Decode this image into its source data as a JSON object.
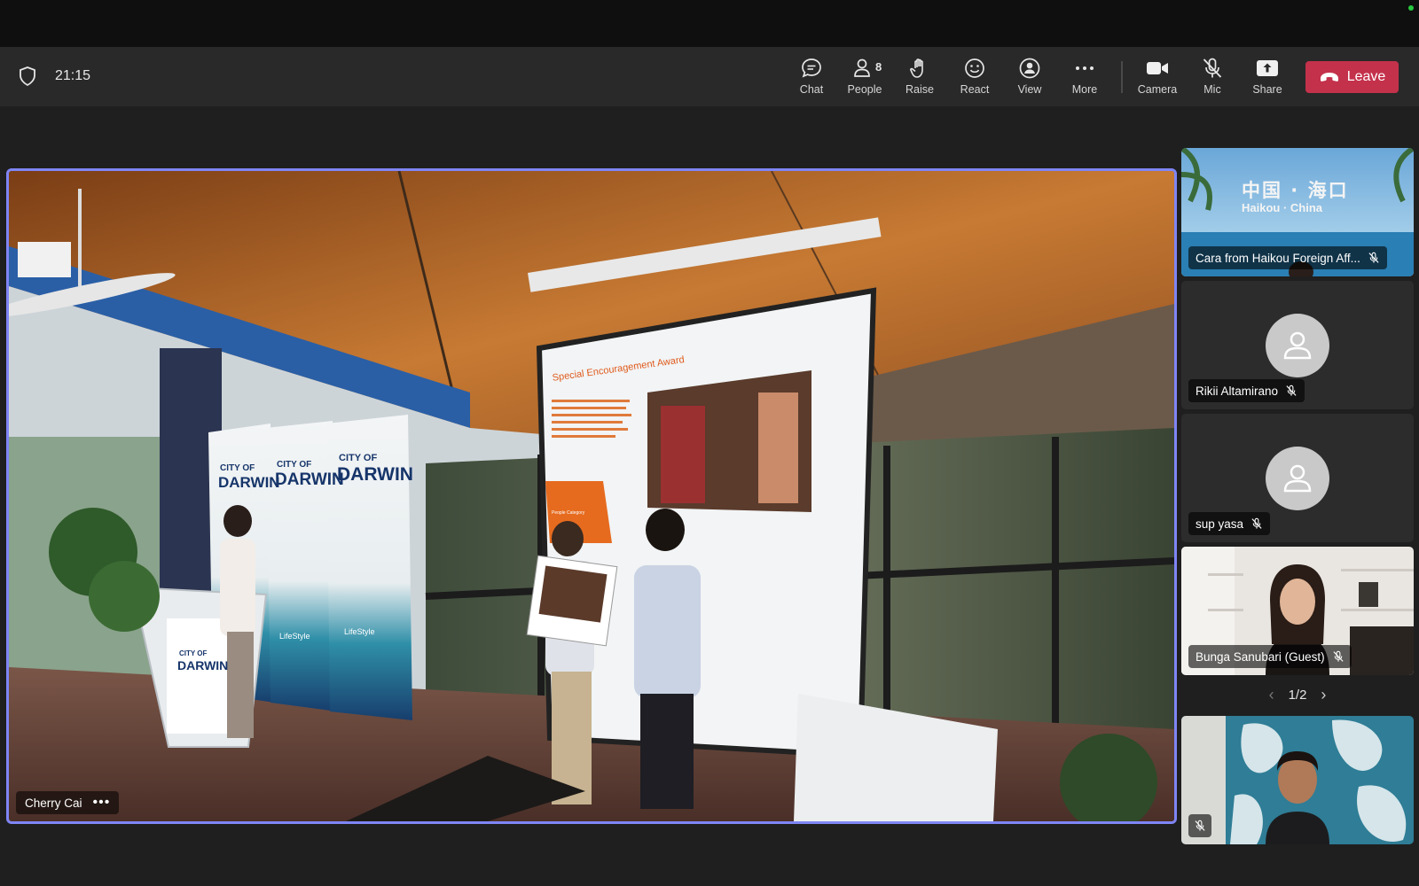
{
  "meeting": {
    "time": "21:15"
  },
  "toolbar": {
    "chat": "Chat",
    "people": "People",
    "people_count": "8",
    "raise": "Raise",
    "react": "React",
    "view": "View",
    "more": "More",
    "camera": "Camera",
    "mic": "Mic",
    "share": "Share",
    "leave": "Leave"
  },
  "main_speaker": {
    "name": "Cherry Cai"
  },
  "slide": {
    "title": "Special Encouragement Award",
    "caption": "People Category"
  },
  "scene": {
    "banner_line1": "CITY OF",
    "banner_line2": "DARWIN",
    "banner_slogan": "LifeStyle"
  },
  "participants": [
    {
      "name": "Cara from Haikou Foreign Aff...",
      "muted": true,
      "bg_text_cn": "中国 · 海口",
      "bg_text_en": "Haikou · China"
    },
    {
      "name": "Rikii Altamirano",
      "muted": true
    },
    {
      "name": "sup yasa",
      "muted": true
    },
    {
      "name": "Bunga Sanubari (Guest)",
      "muted": true
    }
  ],
  "pager": {
    "label": "1/2"
  },
  "self_tile": {
    "muted": true
  },
  "colors": {
    "accent": "#7f85f5",
    "leave": "#c4314b",
    "toolbar": "#292929"
  }
}
